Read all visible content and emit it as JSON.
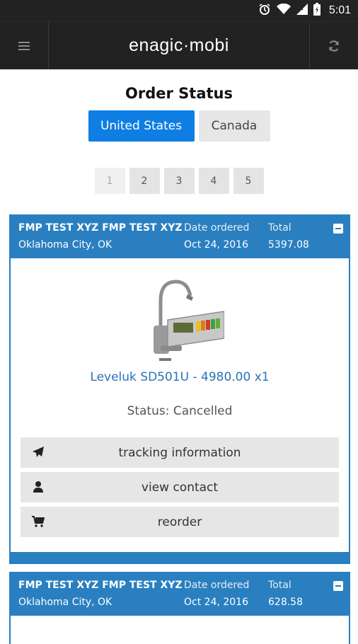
{
  "status_bar": {
    "time": "5:01",
    "icons": [
      "alarm-icon",
      "wifi-icon",
      "signal-icon",
      "battery-icon"
    ]
  },
  "app_bar": {
    "title": "enagic·mobi",
    "menu_icon": "hamburger-menu-icon",
    "refresh_icon": "refresh-icon"
  },
  "page": {
    "title": "Order Status"
  },
  "country_tabs": [
    {
      "label": "United States",
      "active": true
    },
    {
      "label": "Canada",
      "active": false
    }
  ],
  "pagination": [
    "1",
    "2",
    "3",
    "4",
    "5"
  ],
  "orders": [
    {
      "customer": "FMP TEST XYZ FMP TEST XYZ",
      "location": "Oklahoma City, OK",
      "date_label": "Date ordered",
      "date": "Oct 24, 2016",
      "total_label": "Total",
      "total": "5397.08",
      "product": "Leveluk SD501U - 4980.00 x1",
      "status": "Status: Cancelled",
      "actions": [
        {
          "label": "tracking information",
          "icon": "paper-plane-icon"
        },
        {
          "label": "view contact",
          "icon": "user-icon"
        },
        {
          "label": "reorder",
          "icon": "cart-icon"
        }
      ]
    },
    {
      "customer": "FMP TEST XYZ FMP TEST XYZ",
      "location": "Oklahoma City, OK",
      "date_label": "Date ordered",
      "date": "Oct 24, 2016",
      "total_label": "Total",
      "total": "628.58"
    }
  ],
  "colors": {
    "accent": "#0f7ee3",
    "header_blue": "#2a7fc0",
    "link": "#2a73b7",
    "bar": "#222222"
  }
}
